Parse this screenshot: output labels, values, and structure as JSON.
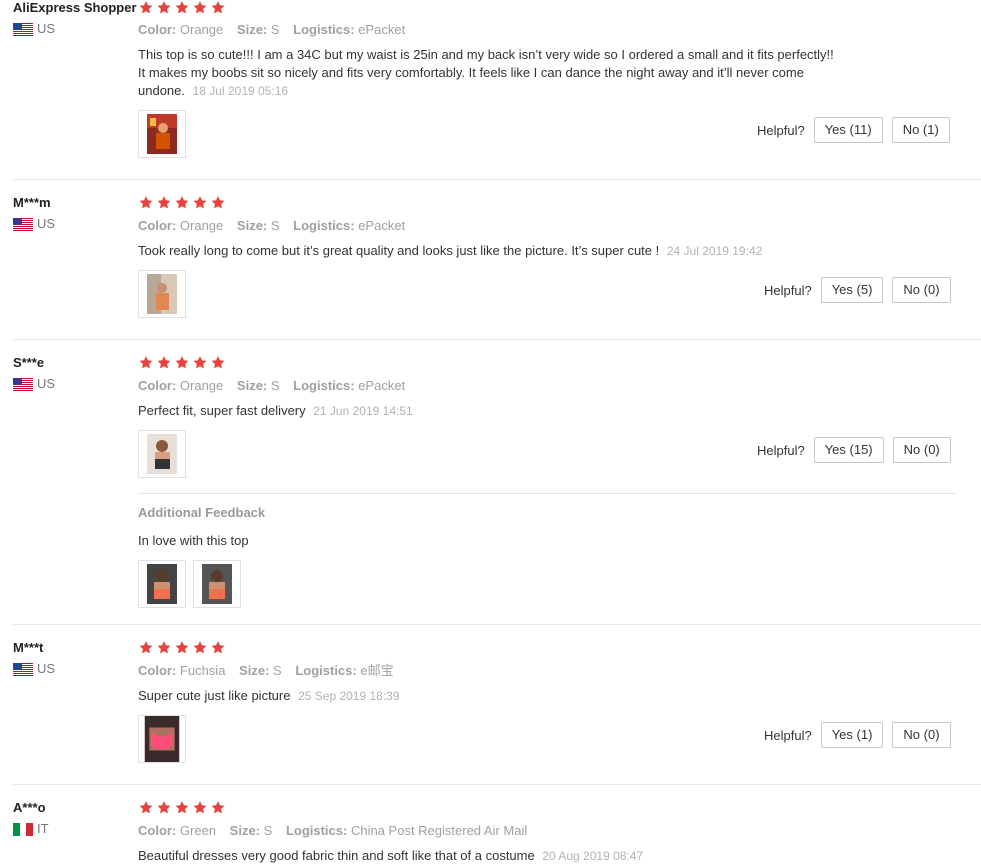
{
  "labels": {
    "color": "Color:",
    "size": "Size:",
    "logistics": "Logistics:",
    "helpful": "Helpful?",
    "additional_feedback": "Additional Feedback"
  },
  "colors": {
    "star": "#e8423c",
    "border": "#e6e6e6",
    "meta_gray": "#a0a0a0"
  },
  "reviews": [
    {
      "name": "AliExpress Shopper",
      "country": "US",
      "flag_icon": "us-flag-icon",
      "rating": 5,
      "color": "Orange",
      "size": "S",
      "logistics": "ePacket",
      "text": "This top is so cute!!! I am a 34C but my waist is 25in and my back isn’t very wide so I ordered a small and it fits perfectly!! It makes my boobs sit so nicely and fits very comfortably. It feels like I can dance the night away and it’ll never come undone.",
      "date": "18 Jul 2019 05:16",
      "yes": "Yes (11)",
      "no": "No (1)"
    },
    {
      "name": "M***m",
      "country": "US",
      "flag_icon": "us-flag-icon",
      "rating": 5,
      "color": "Orange",
      "size": "S",
      "logistics": "ePacket",
      "text": "Took really long to come but it’s great quality and looks just like the picture. It’s super cute !",
      "date": "24 Jul 2019 19:42",
      "yes": "Yes (5)",
      "no": "No (0)"
    },
    {
      "name": "S***e",
      "country": "US",
      "flag_icon": "us-flag-icon",
      "rating": 5,
      "color": "Orange",
      "size": "S",
      "logistics": "ePacket",
      "text": "Perfect fit, super fast delivery",
      "date": "21 Jun 2019 14:51",
      "yes": "Yes (15)",
      "no": "No (0)",
      "additional_text": "In love with this top"
    },
    {
      "name": "M***t",
      "country": "US",
      "flag_icon": "us-flag-icon",
      "rating": 5,
      "color": "Fuchsia",
      "size": "S",
      "logistics": "e邮宝",
      "text": "Super cute just like picture",
      "date": "25 Sep 2019 18:39",
      "yes": "Yes (1)",
      "no": "No (0)"
    },
    {
      "name": "A***o",
      "country": "IT",
      "flag_icon": "it-flag-icon",
      "rating": 5,
      "color": "Green",
      "size": "S",
      "logistics": "China Post Registered Air Mail",
      "text": "Beautiful dresses very good fabric thin and soft like that of a costume",
      "date": "20 Aug 2019 08:47"
    }
  ]
}
